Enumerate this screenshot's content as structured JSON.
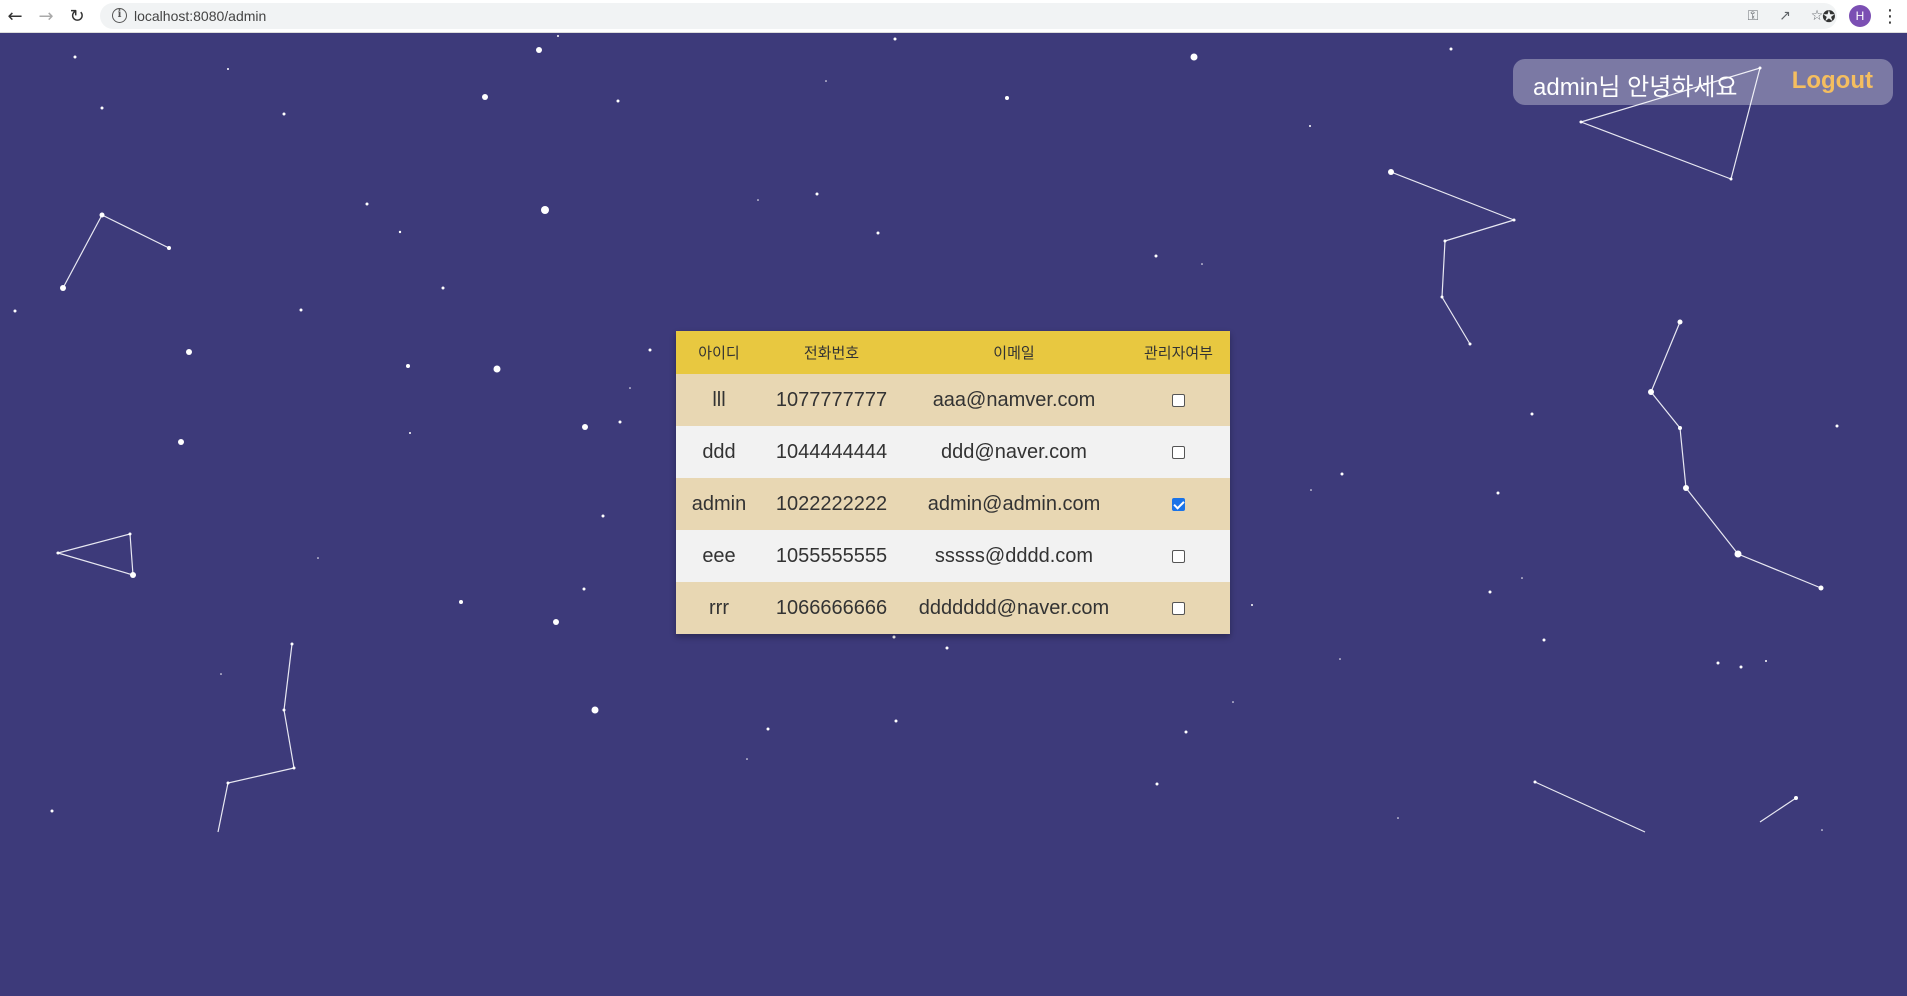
{
  "browser": {
    "url": "localhost:8080/admin",
    "profile_initial": "H"
  },
  "header": {
    "greeting": "admin님 안녕하세요",
    "logout_label": "Logout"
  },
  "table": {
    "columns": [
      "아이디",
      "전화번호",
      "이메일",
      "관리자여부"
    ],
    "rows": [
      {
        "id": "lll",
        "phone": "1077777777",
        "email": "aaa@namver.com",
        "is_admin": false
      },
      {
        "id": "ddd",
        "phone": "1044444444",
        "email": "ddd@naver.com",
        "is_admin": false
      },
      {
        "id": "admin",
        "phone": "1022222222",
        "email": "admin@admin.com",
        "is_admin": true
      },
      {
        "id": "eee",
        "phone": "1055555555",
        "email": "sssss@dddd.com",
        "is_admin": false
      },
      {
        "id": "rrr",
        "phone": "1066666666",
        "email": "ddddddd@naver.com",
        "is_admin": false
      }
    ]
  },
  "colors": {
    "background": "#3d3a7a",
    "table_header": "#e8c840",
    "row_odd": "#e8d7b3",
    "row_even": "#f2f2f2",
    "logout": "#f5be5f"
  }
}
